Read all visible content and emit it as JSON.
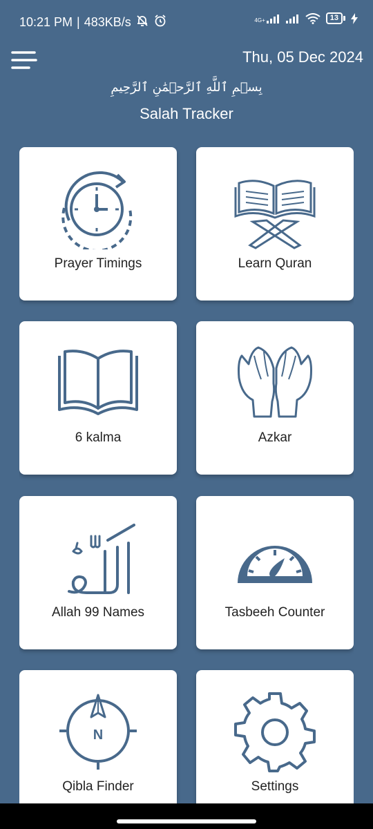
{
  "status_bar": {
    "time": "10:21 PM",
    "separator": "|",
    "speed": "483KB/s",
    "network": "4G+",
    "battery_level": "13",
    "icons": [
      "bell-off-icon",
      "alarm-icon",
      "signal-icon",
      "signal-icon",
      "wifi-icon",
      "battery-icon",
      "charging-icon"
    ]
  },
  "header": {
    "date": "Thu, 05 Dec 2024",
    "bismillah": "بِسۡمِ ٱللَّهِ ٱلرَّحۡمَٰنِ ٱلرَّحِيمِ",
    "title": "Salah Tracker",
    "menu_icon": "hamburger-menu-icon"
  },
  "cards": [
    {
      "label": "Prayer Timings",
      "icon": "clock-cycle-icon"
    },
    {
      "label": "Learn Quran",
      "icon": "quran-stand-icon"
    },
    {
      "label": "6 kalma",
      "icon": "open-book-icon"
    },
    {
      "label": "Azkar",
      "icon": "praying-hands-icon"
    },
    {
      "label": "Allah 99 Names",
      "icon": "allah-calligraphy-icon"
    },
    {
      "label": "Tasbeeh Counter",
      "icon": "gauge-icon"
    },
    {
      "label": "Qibla Finder",
      "icon": "compass-icon",
      "compass_letter": "N"
    },
    {
      "label": "Settings",
      "icon": "gear-icon"
    }
  ],
  "colors": {
    "background": "#48698b",
    "card": "#ffffff",
    "icon": "#48698b",
    "card_text": "#222222"
  }
}
